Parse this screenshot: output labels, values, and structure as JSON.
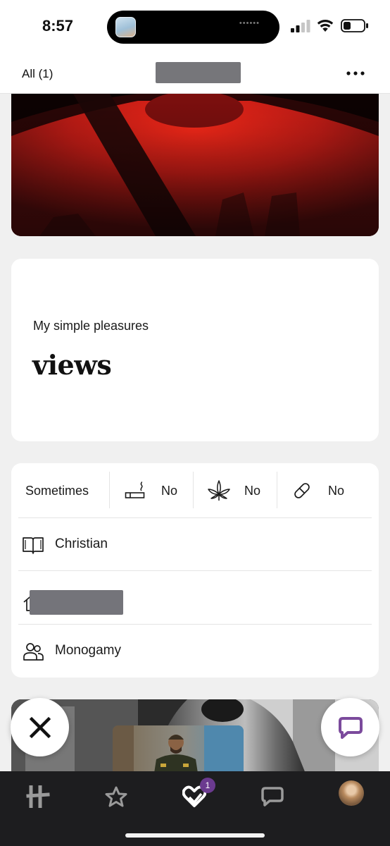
{
  "status_bar": {
    "time": "8:57",
    "island_dots": "••••••",
    "icons": [
      "signal-icon",
      "wifi-icon",
      "battery-icon"
    ]
  },
  "header": {
    "filter_label": "All (1)",
    "more_icon": "more-horizontal-icon"
  },
  "prompt": {
    "question": "My simple pleasures",
    "answer": "views"
  },
  "vitals": {
    "drinking": "Sometimes",
    "smoking": "No",
    "marijuana": "No",
    "drugs": "No",
    "religion": "Christian",
    "relationship_type": "Monogamy",
    "icons": [
      "cigarette-icon",
      "cannabis-leaf-icon",
      "pill-icon",
      "book-icon",
      "home-icon",
      "people-icon"
    ]
  },
  "actions": {
    "pass_icon": "close-icon",
    "chat_icon": "chat-bubble-icon"
  },
  "bottom_nav": {
    "items": [
      "home-logo-icon",
      "star-icon",
      "likes-heart-icon",
      "chat-icon",
      "profile-avatar"
    ],
    "likes_badge": "1"
  },
  "colors": {
    "accent": "#6b3a8f",
    "nav_background": "#1d1d1f",
    "page_background": "#f0f0f0"
  }
}
